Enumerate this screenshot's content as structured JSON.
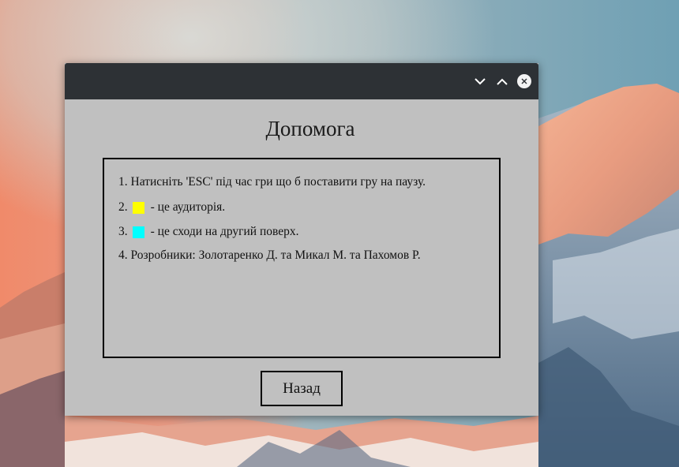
{
  "window": {
    "title": "Допомога",
    "controls": {
      "minimize_icon": "chevron-down-icon",
      "maximize_icon": "chevron-up-icon",
      "close_icon": "close-icon"
    }
  },
  "help": {
    "lines": [
      {
        "number": "1.",
        "text": "Натисніть 'ESC' під час гри що б поставити гру на паузу."
      },
      {
        "number": "2.",
        "text": "- це аудиторія.",
        "swatch_color": "#ffff00"
      },
      {
        "number": "3.",
        "text": "- це сходи на другий поверх.",
        "swatch_color": "#00ffff"
      },
      {
        "number": "4.",
        "text": "Розробники: Золотаренко Д. та Микал М. та Пахомов Р."
      }
    ]
  },
  "buttons": {
    "back_label": "Назад"
  },
  "colors": {
    "titlebar": "#2d3135",
    "window_bg": "#c0c0c0",
    "auditorium": "#ffff00",
    "stairs": "#00ffff"
  }
}
